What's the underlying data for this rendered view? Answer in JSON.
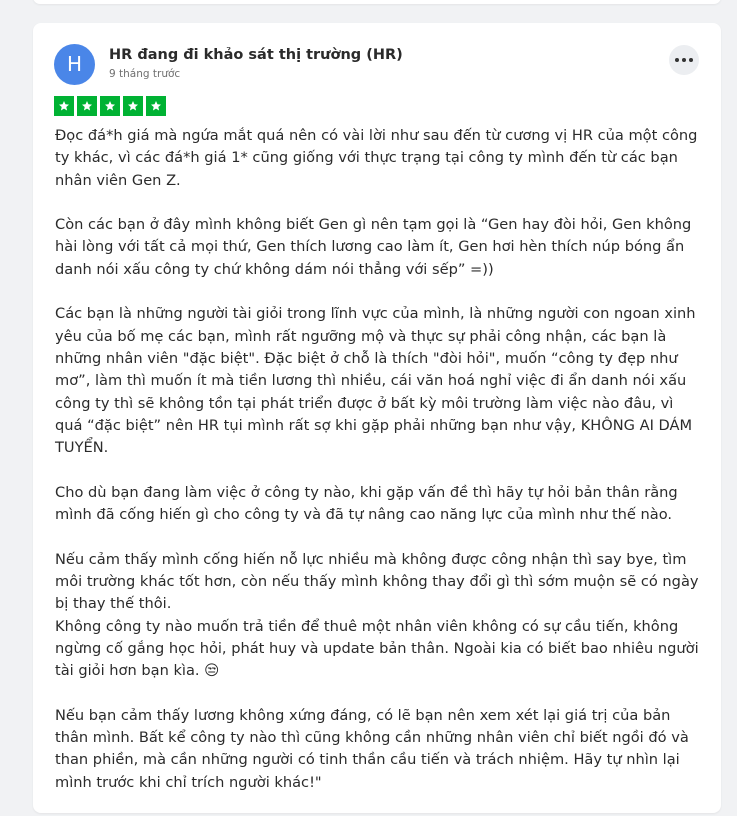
{
  "review": {
    "avatar_letter": "H",
    "author": "HR đang đi khảo sát thị trường (HR)",
    "time": "9 tháng trước",
    "rating": 5,
    "colors": {
      "star": "#00b233",
      "avatar": "#4a86e8"
    },
    "paragraphs": [
      "Đọc đá*h giá mà ngứa mắt quá nên có vài lời như sau đến từ cương vị HR của một công ty khác, vì các đá*h giá 1* cũng giống với thực trạng tại công ty mình đến từ các bạn nhân viên Gen Z.",
      "Còn các bạn ở đây mình không biết Gen gì nên tạm gọi là “Gen hay đòi hỏi, Gen không hài lòng với tất cả mọi thứ, Gen thích lương cao làm ít, Gen hơi hèn thích núp bóng ẩn danh nói xấu công ty chứ không dám nói thẳng với sếp” =))",
      "Các bạn là những người tài giỏi trong lĩnh vực của mình, là những người con ngoan xinh yêu của bố mẹ các bạn, mình rất ngưỡng mộ và thực sự phải công nhận, các bạn là những nhân viên \"đặc biệt\". Đặc biệt ở chỗ là thích \"đòi hỏi\", muốn “công ty đẹp như mơ”, làm thì muốn ít mà tiền lương thì nhiều, cái văn hoá nghỉ việc đi ẩn danh nói xấu công ty thì sẽ không tồn tại phát triển được ở bất kỳ môi trường làm việc nào đâu, vì quá “đặc biệt” nên HR tụi mình rất sợ khi gặp phải những bạn như vậy, KHÔNG AI DÁM TUYỂN.",
      "Cho dù bạn đang làm việc ở công ty nào, khi gặp vấn đề thì hãy tự hỏi bản thân rằng mình đã cống hiến gì cho công ty và đã tự nâng cao năng lực của mình như thế nào.",
      "Nếu cảm thấy mình cống hiến nỗ lực nhiều mà không được công nhận thì say bye, tìm môi trường khác tốt hơn, còn nếu thấy mình không thay đổi gì thì sớm muộn sẽ có ngày bị thay thế thôi.",
      "Không công ty nào muốn trả tiền để thuê một nhân viên không có sự cầu tiến, không ngừng cố gắng học hỏi, phát huy và update bản thân. Ngoài kia có biết bao nhiêu người tài giỏi hơn bạn kìa. 😒",
      "Nếu bạn cảm thấy lương không xứng đáng, có lẽ bạn nên xem xét lại giá trị của bản thân mình. Bất kể công ty nào thì cũng không cần những nhân viên chỉ biết ngồi đó và than phiền, mà cần những người có tinh thần cầu tiến và trách nhiệm. Hãy tự nhìn lại mình trước khi chỉ trích người khác!\""
    ]
  },
  "icons": {
    "more": "more-horizontal-icon",
    "star": "star-icon"
  }
}
